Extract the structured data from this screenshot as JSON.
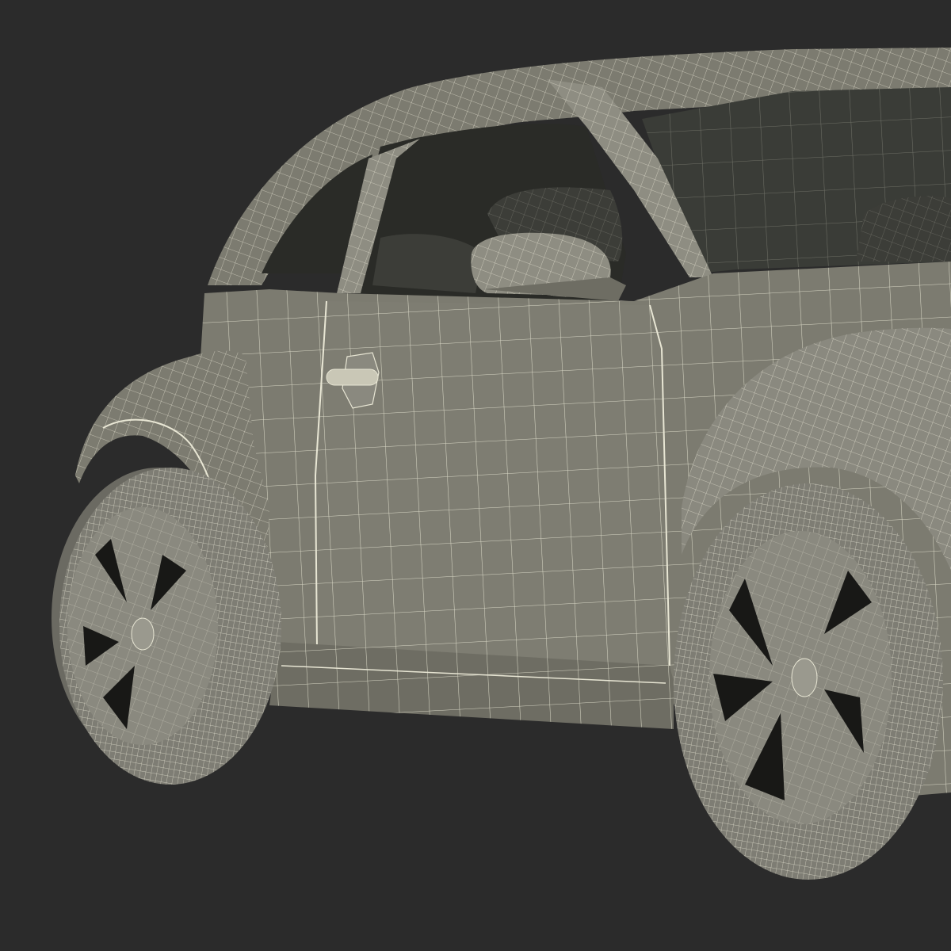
{
  "colors": {
    "background": "#2b2b2b",
    "body": "#7c7b70",
    "body_light": "#8e8d82",
    "body_dark": "#5f5e55",
    "interior": "#2a2b27",
    "glass": "#3a3c37",
    "wire": "#e8e6d4",
    "tire": "#7e7d74",
    "rim": "#8a897f",
    "rim_hole": "#181816"
  },
  "icons": {
    "subject": "car-wireframe-render"
  }
}
